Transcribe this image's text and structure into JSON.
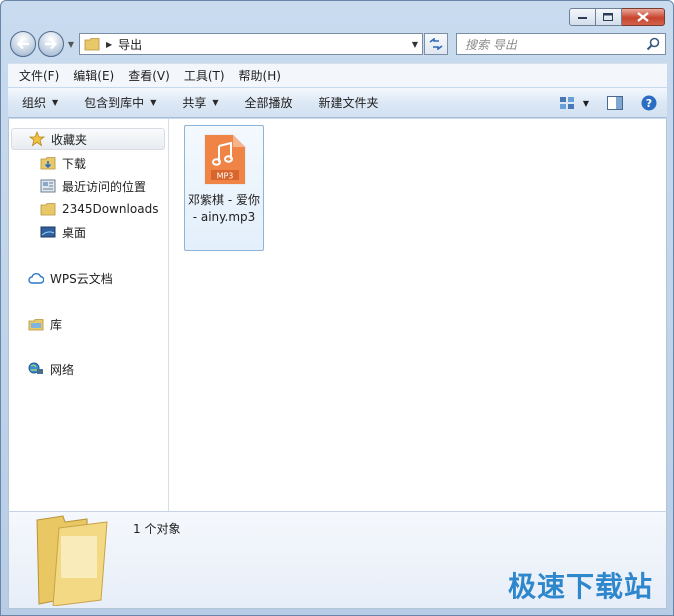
{
  "window": {
    "caption": {
      "minimize": "minimize",
      "maximize": "maximize",
      "close": "close"
    }
  },
  "address": {
    "crumb": "导出",
    "search_placeholder": "搜索 导出"
  },
  "menu": [
    "文件(F)",
    "编辑(E)",
    "查看(V)",
    "工具(T)",
    "帮助(H)"
  ],
  "toolbar": {
    "organize": "组织",
    "include_in_library": "包含到库中",
    "share": "共享",
    "play_all": "全部播放",
    "new_folder": "新建文件夹"
  },
  "navpane": {
    "favorites": "收藏夹",
    "downloads": "下载",
    "recent": "最近访问的位置",
    "downloads2345": "2345Downloads",
    "desktop": "桌面",
    "wps": "WPS云文档",
    "library": "库",
    "network": "网络"
  },
  "files": [
    {
      "name": "邓紫棋 - 爱你 - ainy.mp3",
      "badge": "MP3"
    }
  ],
  "details": {
    "count": "1 个对象"
  },
  "watermark": "极速下载站",
  "colors": {
    "accent": "#1f7fc9",
    "mp3_orange": "#ef7d3c"
  }
}
